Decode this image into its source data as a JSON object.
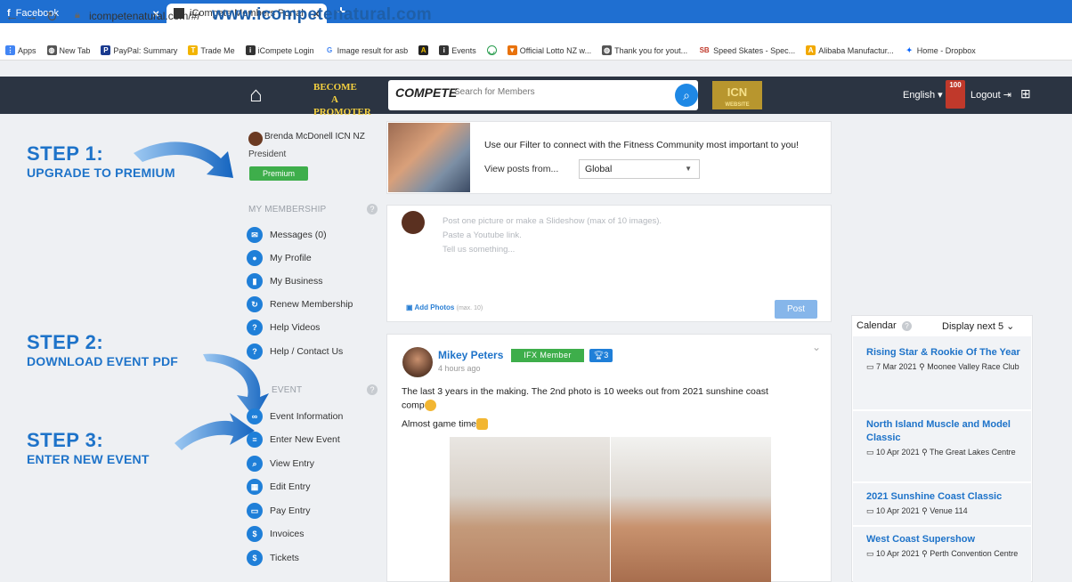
{
  "browser": {
    "tabs": [
      {
        "label": "Facebook"
      },
      {
        "label": "iCompete Members Portal"
      }
    ],
    "new_tab": "+",
    "close": "×",
    "url": "icompetenatural.com/#/",
    "overlay_url": "www.icompetenatural.com",
    "bookmarks": [
      "Apps",
      "New Tab",
      "PayPal: Summary",
      "Trade Me",
      "iCompete Login",
      "Image result for asb",
      "Events",
      "Official Lotto NZ w...",
      "Thank you for yout...",
      "Speed Skates - Spec...",
      "Alibaba Manufactur...",
      "Home - Dropbox"
    ]
  },
  "header": {
    "promoter": "BECOME A PROMOTER",
    "logo": "COMPETE",
    "search_placeholder": "Search for Members",
    "icn": "ICN",
    "icn_sub": "WEBSITE",
    "language": "English ▾",
    "notif_count": "100",
    "logout": "Logout",
    "colors": {
      "bar": "#2b3442",
      "accent": "#1e88e5",
      "gold": "#f4d03f"
    }
  },
  "steps": [
    {
      "title": "STEP 1:",
      "sub": "UPGRADE TO PREMIUM"
    },
    {
      "title": "STEP 2:",
      "sub": "DOWNLOAD EVENT PDF"
    },
    {
      "title": "STEP 3:",
      "sub": "ENTER NEW EVENT"
    }
  ],
  "profile": {
    "name": "Brenda McDonell ICN NZ",
    "role": "President",
    "badge": "Premium"
  },
  "sidebar": {
    "membership_label": "MY MEMBERSHIP",
    "membership_items": [
      {
        "label": "Messages (0)",
        "icon": "messenger-icon"
      },
      {
        "label": "My Profile",
        "icon": "user-icon"
      },
      {
        "label": "My Business",
        "icon": "chart-icon"
      },
      {
        "label": "Renew Membership",
        "icon": "renew-icon"
      },
      {
        "label": "Help Videos",
        "icon": "question-icon"
      },
      {
        "label": "Help / Contact Us",
        "icon": "question-icon"
      }
    ],
    "event_label": "EVENT",
    "event_items": [
      {
        "label": "Event Information",
        "icon": "link-icon"
      },
      {
        "label": "Enter New Event",
        "icon": "form-icon"
      },
      {
        "label": "View Entry",
        "icon": "search-icon"
      },
      {
        "label": "Edit Entry",
        "icon": "calendar-icon"
      },
      {
        "label": "Pay Entry",
        "icon": "card-icon"
      },
      {
        "label": "Invoices",
        "icon": "dollar-icon"
      },
      {
        "label": "Tickets",
        "icon": "dollar-icon"
      }
    ]
  },
  "filter": {
    "text": "Use our Filter to connect with the Fitness Community most important to you!",
    "view_label": "View posts from...",
    "selected": "Global"
  },
  "composer": {
    "hints": [
      "Post one picture or make a Slideshow (max of 10 images).",
      "Paste a Youtube link.",
      "Tell us something..."
    ],
    "add_photos": "Add Photos",
    "add_photos_note": "(max. 10)",
    "post_button": "Post"
  },
  "post": {
    "author": "Mikey Peters",
    "badge": "IFX Member",
    "trophy_count": "3",
    "time": "4 hours ago",
    "text1": "The last 3 years in the making. The 2nd photo is 10 weeks out from 2021 sunshine coast",
    "text2": "comp",
    "text3": "Almost game time"
  },
  "calendar": {
    "title": "Calendar",
    "display_next": "Display next 5",
    "events": [
      {
        "title": "Rising Star & Rookie Of The Year",
        "date": "7 Mar 2021",
        "venue": "Moonee Valley Race Club"
      },
      {
        "title": "North Island Muscle and Model Classic",
        "date": "10 Apr 2021",
        "venue": "The Great Lakes Centre"
      },
      {
        "title": "2021 Sunshine Coast Classic",
        "date": "10 Apr 2021",
        "venue": "Venue 114"
      },
      {
        "title": "West Coast Supershow",
        "date": "10 Apr 2021",
        "venue": "Perth Convention Centre"
      }
    ]
  }
}
